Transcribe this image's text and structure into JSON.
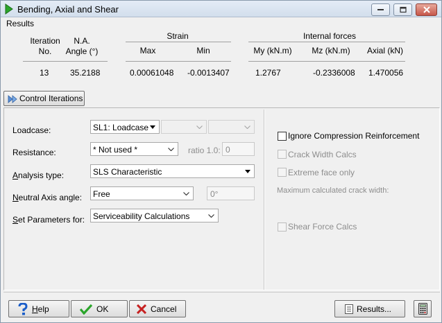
{
  "window": {
    "title": "Bending, Axial and Shear",
    "controls": [
      "minimize",
      "maximize",
      "close"
    ]
  },
  "results": {
    "section_label": "Results",
    "headers": {
      "iteration": [
        "Iteration",
        "No."
      ],
      "na_angle": [
        "N.A.",
        "Angle (°)"
      ],
      "strain_group": "Strain",
      "strain_max": "Max",
      "strain_min": "Min",
      "forces_group": "Internal forces",
      "my": "My (kN.m)",
      "mz": "Mz (kN.m)",
      "axial": "Axial (kN)"
    },
    "values": {
      "iteration": "13",
      "na_angle": "35.2188",
      "strain_max": "0.00061048",
      "strain_min": "-0.0013407",
      "my": "1.2767",
      "mz": "-0.2336008",
      "axial": "1.470056"
    }
  },
  "control_iterations_button": "Control Iterations",
  "form": {
    "loadcase": {
      "label": "Loadcase:",
      "value": "SL1: Loadcase",
      "extra1": "",
      "extra2": ""
    },
    "resistance": {
      "label": "Resistance:",
      "value": "* Not used *",
      "ratio_label": "ratio 1.0:",
      "ratio_value": "0"
    },
    "analysis_type": {
      "label": "Analysis type:",
      "value": "SLS Characteristic"
    },
    "neutral_axis": {
      "label": "Neutral Axis angle:",
      "value": "Free",
      "angle_value": "0°"
    },
    "set_parameters": {
      "label": "Set Parameters for:",
      "value": "Serviceability Calculations"
    }
  },
  "options": {
    "ignore_compression": {
      "label": "Ignore Compression Reinforcement",
      "checked": false,
      "enabled": true
    },
    "crack_width": {
      "label": "Crack Width Calcs",
      "checked": false,
      "enabled": false
    },
    "extreme_face": {
      "label": "Extreme face only",
      "checked": false,
      "enabled": false
    },
    "max_crack_width_label": "Maximum calculated crack width:",
    "shear_force": {
      "label": "Shear Force Calcs",
      "checked": false,
      "enabled": false
    }
  },
  "footer": {
    "help": "Help",
    "ok": "OK",
    "cancel": "Cancel",
    "results": "Results..."
  },
  "icons": {
    "app": "green-play-icon",
    "control_iterations": "double-arrow-icon",
    "help": "question-icon",
    "ok": "check-icon",
    "cancel": "x-icon",
    "calculator": "calculator-icon"
  },
  "colors": {
    "accent_green": "#2aa52a",
    "cancel_red": "#c62121",
    "close_button": "#c7574a"
  }
}
